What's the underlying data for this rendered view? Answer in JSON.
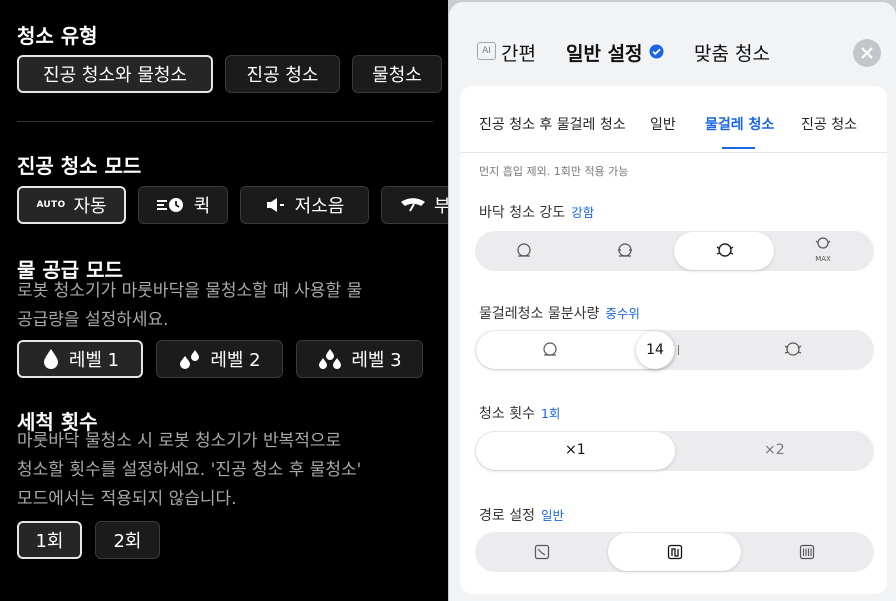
{
  "left": {
    "cleaning_type": {
      "title": "청소 유형",
      "options": [
        "진공 청소와 물청소",
        "진공 청소",
        "물청소"
      ],
      "selected": 0
    },
    "vacuum_mode": {
      "title": "진공 청소 모드",
      "options": [
        {
          "label": "자동",
          "badge": "AUTO",
          "icon": "auto-icon"
        },
        {
          "label": "퀵",
          "icon": "quick-icon"
        },
        {
          "label": "저소음",
          "icon": "quiet-speaker-icon"
        },
        {
          "label": "부",
          "icon": "boost-fan-icon"
        }
      ],
      "selected": 0
    },
    "water_mode": {
      "title": "물 공급 모드",
      "desc": [
        "로봇 청소기가 마룻바닥을 물청소할 때 사용할 물",
        "공급량을 설정하세요."
      ],
      "options": [
        "레벨 1",
        "레벨 2",
        "레벨 3"
      ],
      "selected": 0
    },
    "wash_count": {
      "title": "세척 횟수",
      "desc": [
        "마룻바닥 물청소 시 로봇 청소기가 반복적으로",
        "청소할 횟수를 설정하세요. '진공 청소 후 물청소'",
        "모드에서는 적용되지 않습니다."
      ],
      "options": [
        "1회",
        "2회"
      ],
      "selected": 0
    }
  },
  "right": {
    "top_tabs": [
      {
        "label": "간편",
        "badge": "AI"
      },
      {
        "label": "일반 설정",
        "active": true
      },
      {
        "label": "맞춤 청소"
      }
    ],
    "sub_tabs": [
      "진공 청소 후 물걸레 청소",
      "일반",
      "물걸레 청소",
      "진공 청소"
    ],
    "active_sub_tab": 2,
    "note": "먼지 흡입 제외. 1회만 적용 가능",
    "floor_intensity": {
      "label": "바닥 청소 강도",
      "value": "강함",
      "levels": 4,
      "selected": 2,
      "max_label": "MAX"
    },
    "mop_water": {
      "label": "물걸레청소 물분사량",
      "value": "중수위",
      "slider_value": "14",
      "fraction": 0.45
    },
    "clean_count": {
      "label": "청소 횟수",
      "value": "1회",
      "options": [
        "×1",
        "×2"
      ],
      "selected": 0
    },
    "route": {
      "label": "경로 설정",
      "value": "일반",
      "options": [
        "route-edge-icon",
        "route-standard-icon",
        "route-dense-icon"
      ],
      "selected": 1
    }
  },
  "colors": {
    "accent": "#1a66e6",
    "dark_bg": "#000000"
  }
}
